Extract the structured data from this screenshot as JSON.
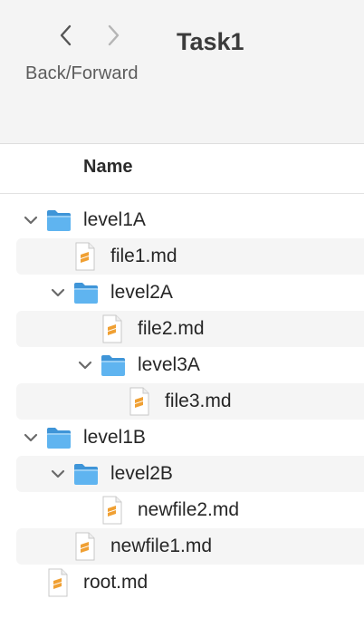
{
  "toolbar": {
    "title": "Task1",
    "nav_caption": "Back/Forward"
  },
  "columns": {
    "name": "Name"
  },
  "tree": [
    {
      "label": "level1A",
      "kind": "folder",
      "depth": 0,
      "expanded": true
    },
    {
      "label": "file1.md",
      "kind": "file",
      "depth": 1
    },
    {
      "label": "level2A",
      "kind": "folder",
      "depth": 1,
      "expanded": true
    },
    {
      "label": "file2.md",
      "kind": "file",
      "depth": 2
    },
    {
      "label": "level3A",
      "kind": "folder",
      "depth": 2,
      "expanded": true
    },
    {
      "label": "file3.md",
      "kind": "file",
      "depth": 3
    },
    {
      "label": "level1B",
      "kind": "folder",
      "depth": 0,
      "expanded": true
    },
    {
      "label": "level2B",
      "kind": "folder",
      "depth": 1,
      "expanded": true
    },
    {
      "label": "newfile2.md",
      "kind": "file",
      "depth": 2
    },
    {
      "label": "newfile1.md",
      "kind": "file",
      "depth": 1
    },
    {
      "label": "root.md",
      "kind": "file",
      "depth": 0
    }
  ],
  "colors": {
    "folder": "#5fb4f0",
    "folder_dark": "#3f95d8",
    "file_accent": "#f0a033"
  }
}
